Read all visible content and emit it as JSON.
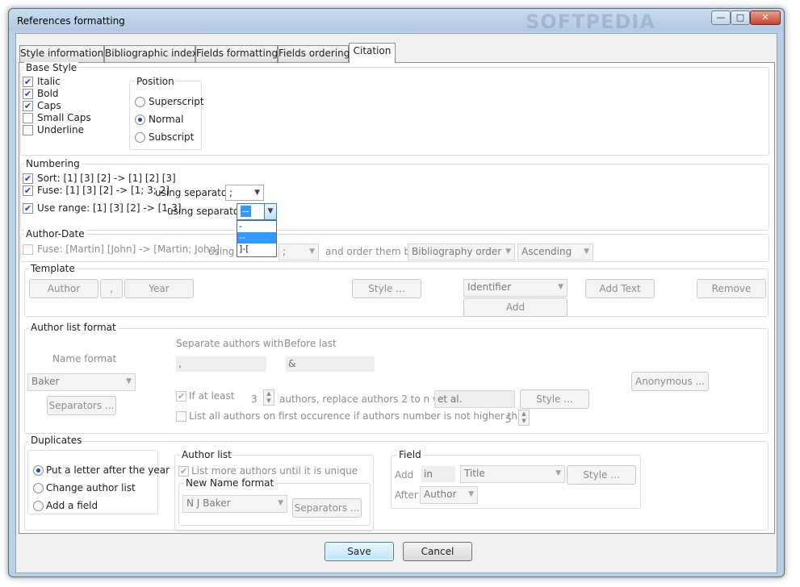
{
  "window": {
    "title": "References formatting",
    "watermark": "SOFTPEDIA",
    "minimize_icon": "—",
    "maximize_icon": "□",
    "close_icon": "✕"
  },
  "tabs": [
    {
      "label": "Style informations"
    },
    {
      "label": "Bibliographic index"
    },
    {
      "label": "Fields formatting"
    },
    {
      "label": "Fields ordering"
    },
    {
      "label": "Citation"
    }
  ],
  "base_style": {
    "legend": "Base Style",
    "italic": {
      "label": "Italic",
      "checked": true
    },
    "bold": {
      "label": "Bold",
      "checked": true
    },
    "caps": {
      "label": "Caps",
      "checked": true
    },
    "small_caps": {
      "label": "Small Caps",
      "checked": false
    },
    "underline": {
      "label": "Underline",
      "checked": false
    },
    "position": {
      "legend": "Position",
      "superscript": "Superscript",
      "normal": "Normal",
      "subscript": "Subscript",
      "selected": "Normal"
    }
  },
  "numbering": {
    "legend": "Numbering",
    "sort": "Sort: [1] [3] [2] -> [1] [2] [3]",
    "fuse": "Fuse: [1] [3] [2] -> [1; 3; 2]",
    "fuse_sep_label": "using separator",
    "fuse_sep_value": ";",
    "range": "Use range: [1] [3] [2] -> [1-3]",
    "range_sep_label": "using separator",
    "range_sep_value": "--",
    "range_options": [
      "-",
      "--",
      "]-["
    ],
    "range_selected": "--"
  },
  "author_date": {
    "legend": "Author-Date",
    "fuse": "Fuse: [Martin] [John] -> [Martin; John]",
    "using": "using",
    "sep_value": ";",
    "order_label": "and order them by",
    "order_by": "Bibliography order",
    "direction": "Ascending"
  },
  "template": {
    "legend": "Template",
    "author": "Author",
    "comma": ",",
    "year": "Year",
    "style": "Style ...",
    "identifier": "Identifier",
    "add_text": "Add Text",
    "remove": "Remove",
    "add": "Add"
  },
  "author_list_format": {
    "legend": "Author list format",
    "name_format_label": "Name format",
    "name_format": "Baker",
    "separators": "Separators ...",
    "sep_authors_label": "Separate authors with",
    "sep_authors": ",",
    "before_last_label": "Before last",
    "before_last": "&",
    "if_at_least": "If at least",
    "count": "3",
    "replace_text": "authors, replace authors 2 to n with",
    "et_al": "et al.",
    "style": "Style ...",
    "anonymous": "Anonymous ...",
    "list_all": "List all authors on first occurence if authors number is not higher than",
    "list_all_count": "5"
  },
  "duplicates": {
    "legend": "Duplicates",
    "letter": "Put a letter after the year",
    "change": "Change author list",
    "add_field": "Add a field",
    "selected": "Put a letter after the year",
    "author_list": {
      "legend": "Author list",
      "list_more": "List more authors until it is unique",
      "name_format_legend": "New Name format",
      "name_format": "N J Baker",
      "separators": "Separators ..."
    },
    "field": {
      "legend": "Field",
      "add_label": "Add",
      "in": "in",
      "title": "Title",
      "style": "Style ...",
      "after_label": "After",
      "after": "Author"
    }
  },
  "footer": {
    "save": "Save",
    "cancel": "Cancel"
  },
  "colors": {
    "accent": "#3399ff",
    "titlebar": "#bcd0e5"
  }
}
